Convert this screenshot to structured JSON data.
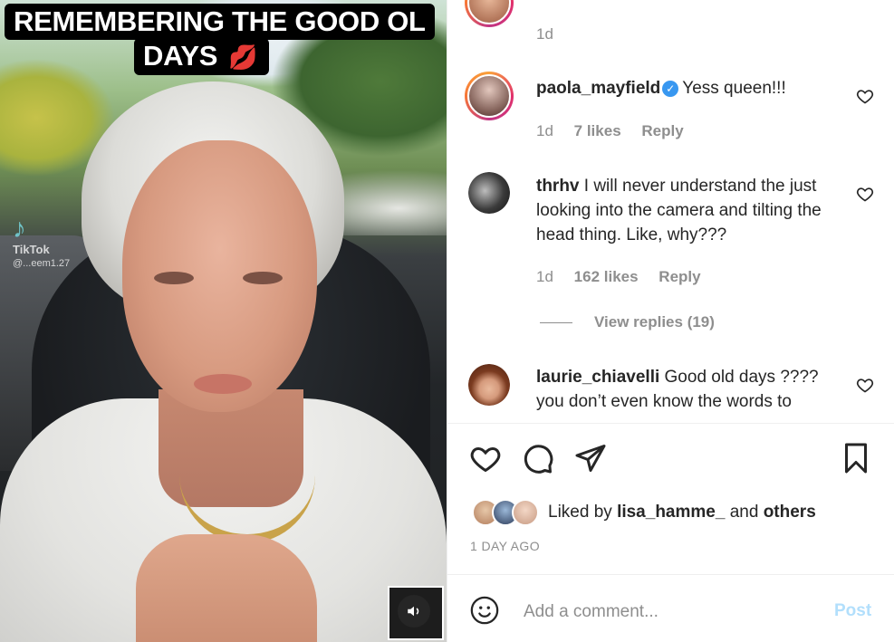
{
  "video": {
    "caption_line1": "REMEMBERING THE GOOD OL",
    "caption_line2": "DAYS",
    "caption_emoji": "💋",
    "watermark_logo": "TikTok",
    "watermark_user": "@...eem1.27",
    "sound_icon": "speaker-icon"
  },
  "comments": {
    "top_partial": {
      "time": "1d"
    },
    "items": [
      {
        "username": "paola_mayfield",
        "verified": true,
        "text": "Yess queen!!!",
        "time": "1d",
        "likes": "7 likes",
        "reply": "Reply"
      },
      {
        "username": "thrhv",
        "verified": false,
        "text": "I will never understand the just looking into the camera and tilting the head thing. Like, why???",
        "time": "1d",
        "likes": "162 likes",
        "reply": "Reply",
        "view_replies": "View replies (19)"
      },
      {
        "username": "laurie_chiavelli",
        "verified": false,
        "text": "Good old days ???? you don’t even know the words to"
      }
    ]
  },
  "actions": {
    "like_icon": "heart-icon",
    "comment_icon": "comment-icon",
    "share_icon": "send-icon",
    "save_icon": "bookmark-icon"
  },
  "likes": {
    "prefix": "Liked by",
    "user": "lisa_hamme_",
    "middle": "and",
    "others": "others"
  },
  "posted": "1 DAY AGO",
  "add_comment": {
    "placeholder": "Add a comment...",
    "post_label": "Post"
  },
  "colors": {
    "text": "#262626",
    "muted": "#8e8e8e",
    "verified": "#3897f0",
    "post_disabled": "#b2dffc"
  }
}
